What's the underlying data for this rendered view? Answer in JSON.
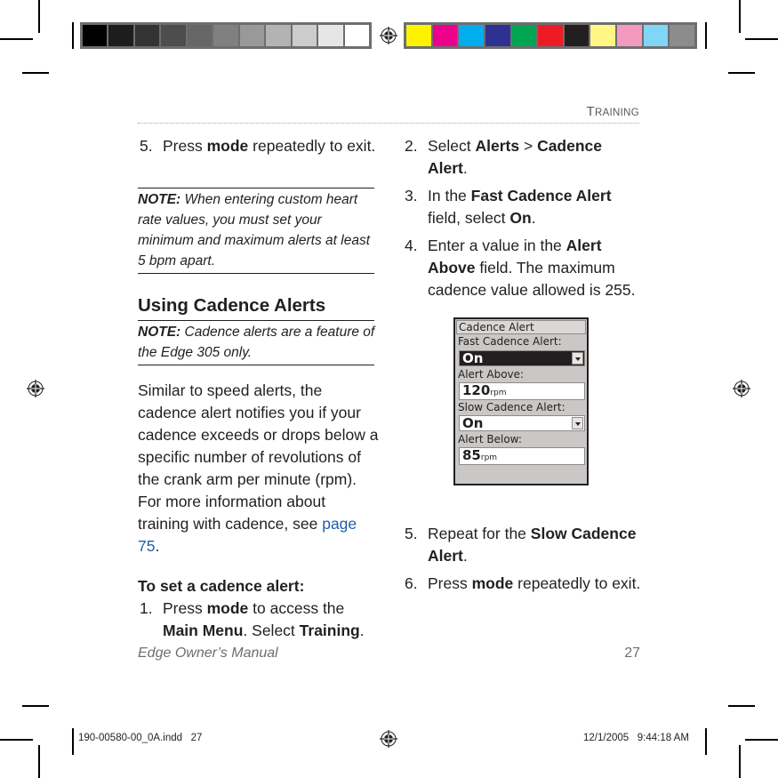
{
  "printer_marks": {
    "gray_swatches": [
      "#000000",
      "#1d1d1d",
      "#333333",
      "#4d4d4d",
      "#666666",
      "#808080",
      "#999999",
      "#b3b3b3",
      "#cccccc",
      "#e6e6e6",
      "#ffffff"
    ],
    "color_swatches": [
      "#fff200",
      "#ec008c",
      "#00aeef",
      "#2e3192",
      "#00a651",
      "#ed1c24",
      "#231f20",
      "#fff685",
      "#f49ac1",
      "#7fd6f7",
      "#8c8c8c"
    ]
  },
  "header": {
    "running_head_first": "T",
    "running_head_rest": "RAINING"
  },
  "left_column": {
    "step5": {
      "num": "5.",
      "pre": "Press ",
      "bold": "mode",
      "post": " repeatedly to exit."
    },
    "note1": {
      "label": "NOTE:",
      "text": " When entering custom heart rate values, you must set your minimum and maximum alerts at least 5 bpm apart."
    },
    "heading": "Using Cadence Alerts",
    "note2": {
      "label": "NOTE:",
      "text": " Cadence alerts are a feature of the Edge 305 only."
    },
    "body_pre": "Similar to speed alerts, the cadence alert notifies you if your cadence exceeds or drops below a specific number of revolutions of the crank arm per minute (rpm). For more information about training with cadence, see ",
    "body_link": "page 75",
    "body_post": ".",
    "procedure_title": "To set a cadence alert:",
    "step1": {
      "num": "1.",
      "pre": "Press ",
      "bold1": "mode",
      "mid": " to access the ",
      "bold2": "Main Menu",
      "mid2": ". Select ",
      "bold3": "Training",
      "post": "."
    }
  },
  "right_column": {
    "step2": {
      "num": "2.",
      "pre": "Select ",
      "bold1": "Alerts",
      "sep": " > ",
      "bold2": "Cadence Alert",
      "post": "."
    },
    "step3": {
      "num": "3.",
      "pre": "In the ",
      "bold1": "Fast Cadence Alert",
      "mid": " field, select ",
      "bold2": "On",
      "post": "."
    },
    "step4": {
      "num": "4.",
      "pre": "Enter a value in the ",
      "bold1": "Alert Above",
      "post": " field. The maximum cadence value allowed is 255."
    },
    "step5": {
      "num": "5.",
      "pre": "Repeat for the ",
      "bold1": "Slow Cadence Alert",
      "post": "."
    },
    "step6": {
      "num": "6.",
      "pre": "Press ",
      "bold1": "mode",
      "post": " repeatedly to exit."
    }
  },
  "device_screen": {
    "title": "Cadence Alert",
    "fast_label": "Fast Cadence Alert:",
    "fast_value": "On",
    "above_label": "Alert Above:",
    "above_value": "120",
    "above_unit": "rpm",
    "slow_label": "Slow Cadence Alert:",
    "slow_value": "On",
    "below_label": "Alert Below:",
    "below_value": "85",
    "below_unit": "rpm"
  },
  "footer": {
    "manual_title": "Edge Owner’s Manual",
    "page_number": "27"
  },
  "slug": {
    "file": "190-00580-00_0A.indd   27",
    "timestamp": "12/1/2005   9:44:18 AM"
  }
}
